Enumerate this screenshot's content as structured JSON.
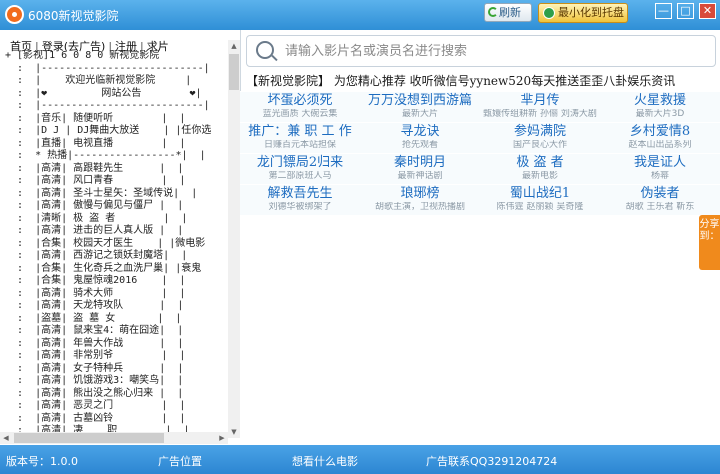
{
  "window": {
    "title": "6080新视觉影院",
    "refresh_label": "刷新",
    "minimize_tray_label": "最小化到托盘",
    "min_glyph": "—",
    "max_glyph": "□",
    "close_glyph": "✕"
  },
  "nav": {
    "items": [
      "首页",
      "登录(去广告)",
      "注册",
      "求片"
    ],
    "separator": "|"
  },
  "tree": {
    "rows": [
      "+ [影视]1 6 0 8 0 新视觉影院",
      "  :  |---------------------------|",
      "  :  |    欢迎光临新视觉影院     |",
      "  :  |❤         网站公告        ❤|",
      "  :  |---------------------------|",
      "  :  |音乐| 随便听听        |  |",
      "  :  |D J | DJ舞曲大放送    | |任你选",
      "  :  |直播| 电视直播        |  |",
      "  :  * 热播|-----------------*|  |",
      "  :  |高清| 高跟鞋先生      |  |",
      "  :  |高清| 风口青春        |  |",
      "  :  |高清| 圣斗士星矢：圣域传说|  |",
      "  :  |高清| 傲慢与偏见与僵尸 |  |",
      "  :  |清晰| 极 盗 者        |  |",
      "  :  |高清| 进击的巨人真人版 |  |",
      "  :  |合集| 校园天才医生    | |微电影",
      "  :  |高清| 西游记之锁妖封魔塔|  |",
      "  :  |合集| 生化奇兵之血洗尸巢| |衰鬼",
      "  :  |合集| 鬼屋惊魂2016    |  |",
      "  :  |高清| 骑术大师        |  |",
      "  :  |高清| 天龙特攻队      |  |",
      "  :  |盗墓| 盗 墓 女       |  |",
      "  :  |高清| 鼠来宝4：萌在囧途|  |",
      "  :  |高清| 年兽大作战      |  |",
      "  :  |高清| 非常别爷        |  |",
      "  :  |高清| 女子特种兵      |  |",
      "  :  |高清| 饥饿游戏3：嘲笑鸟|  |",
      "  :  |高清| 熊出没之熊心归来 |  |",
      "  :  |高清| 恶灵之门        |  |",
      "  :  |高清| 古墓凶铃        |  |",
      "  :  |高清| 凄    职        |  |"
    ]
  },
  "search": {
    "placeholder": "请输入影片名或演员名进行搜索"
  },
  "banner": {
    "text": "【新视觉影院】 为您精心推荐  收听微信号yynew520每天推送歪歪八卦娱乐资讯"
  },
  "grid": [
    {
      "title": "坏蛋必须死",
      "sub": "蓝光画质 大碗云集"
    },
    {
      "title": "万万没想到西游篇",
      "sub": "最新大片"
    },
    {
      "title": "芈月传",
      "sub": "甄嬛传组耕新 孙俪 刘涛大剧"
    },
    {
      "title": "火星救援",
      "sub": "最新大片3D"
    },
    {
      "title": "推广：兼 职 工 作",
      "sub": "日赚百元本站担保"
    },
    {
      "title": "寻龙诀",
      "sub": "抢先观看"
    },
    {
      "title": "参妈满院",
      "sub": "国产良心大作"
    },
    {
      "title": "乡村爱情8",
      "sub": "赵本山出品系列"
    },
    {
      "title": "龙门镖局2归来",
      "sub": "第二部原班人马"
    },
    {
      "title": "秦时明月",
      "sub": "最新神话剧"
    },
    {
      "title": "极 盗 者",
      "sub": "最新电影"
    },
    {
      "title": "我是证人",
      "sub": "杨幂"
    },
    {
      "title": "解救吾先生",
      "sub": "刘德华被绑架了"
    },
    {
      "title": "琅琊榜",
      "sub": "胡歌主演，卫视热播剧"
    },
    {
      "title": "蜀山战纪1",
      "sub": "陈伟霆 赵丽颖 吴奇隆"
    },
    {
      "title": "伪装者",
      "sub": "胡歌 王乐君 靳东"
    }
  ],
  "share_tab": {
    "label": "分享到："
  },
  "status": {
    "version": "版本号：1.0.0",
    "ad_position": "广告位置",
    "want_movie": "想看什么电影",
    "ad_contact": "广告联系QQ3291204724"
  }
}
